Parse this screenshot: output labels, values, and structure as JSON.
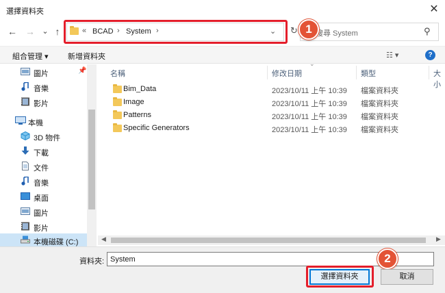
{
  "window": {
    "title": "選擇資料夾",
    "close_glyph": "✕"
  },
  "nav": {
    "back_glyph": "←",
    "forward_glyph": "→",
    "recent_glyph": "⌄",
    "up_glyph": "↑"
  },
  "address": {
    "overflow": "«",
    "crumbs": [
      "BCAD",
      "System"
    ],
    "sep_glyph": "›",
    "dropdown_glyph": "⌄",
    "refresh_glyph": "↻"
  },
  "search": {
    "placeholder": "搜尋 System",
    "icon_glyph": "⚲"
  },
  "badges": {
    "one": "1",
    "two": "2"
  },
  "toolbar": {
    "organize": "組合管理 ▾",
    "new_folder": "新增資料夾",
    "view_glyph": "☷ ▾",
    "help": "?"
  },
  "sidebar": {
    "pin_glyph": "📌",
    "items": [
      {
        "label": "圖片",
        "icon": "pictures-icon"
      },
      {
        "label": "音樂",
        "icon": "music-icon"
      },
      {
        "label": "影片",
        "icon": "videos-icon"
      },
      {
        "label": "本機",
        "icon": "this-pc-icon"
      },
      {
        "label": "3D 物件",
        "icon": "3d-objects-icon"
      },
      {
        "label": "下載",
        "icon": "downloads-icon"
      },
      {
        "label": "文件",
        "icon": "documents-icon"
      },
      {
        "label": "音樂",
        "icon": "music-icon"
      },
      {
        "label": "桌面",
        "icon": "desktop-icon"
      },
      {
        "label": "圖片",
        "icon": "pictures-icon"
      },
      {
        "label": "影片",
        "icon": "videos-icon"
      },
      {
        "label": "本機磁碟 (C:)",
        "icon": "drive-icon"
      }
    ]
  },
  "list": {
    "headers": {
      "name": "名稱",
      "date": "修改日期",
      "type": "類型",
      "size": "大小"
    },
    "sort_glyph": "⌄",
    "rows": [
      {
        "name": "Bim_Data",
        "date": "2023/10/11 上午 10:39",
        "type": "檔案資料夾"
      },
      {
        "name": "Image",
        "date": "2023/10/11 上午 10:39",
        "type": "檔案資料夾"
      },
      {
        "name": "Patterns",
        "date": "2023/10/11 上午 10:39",
        "type": "檔案資料夾"
      },
      {
        "name": "Specific Generators",
        "date": "2023/10/11 上午 10:39",
        "type": "檔案資料夾"
      }
    ],
    "hscroll_left": "◀",
    "hscroll_right": "▶"
  },
  "footer": {
    "folder_label": "資料夾:",
    "folder_value": "System",
    "select_button": "選擇資料夾",
    "cancel_button": "取消"
  },
  "colors": {
    "highlight": "#e41e2b",
    "badge": "#e35336",
    "accent": "#0078d7",
    "folder": "#f3c85a"
  }
}
